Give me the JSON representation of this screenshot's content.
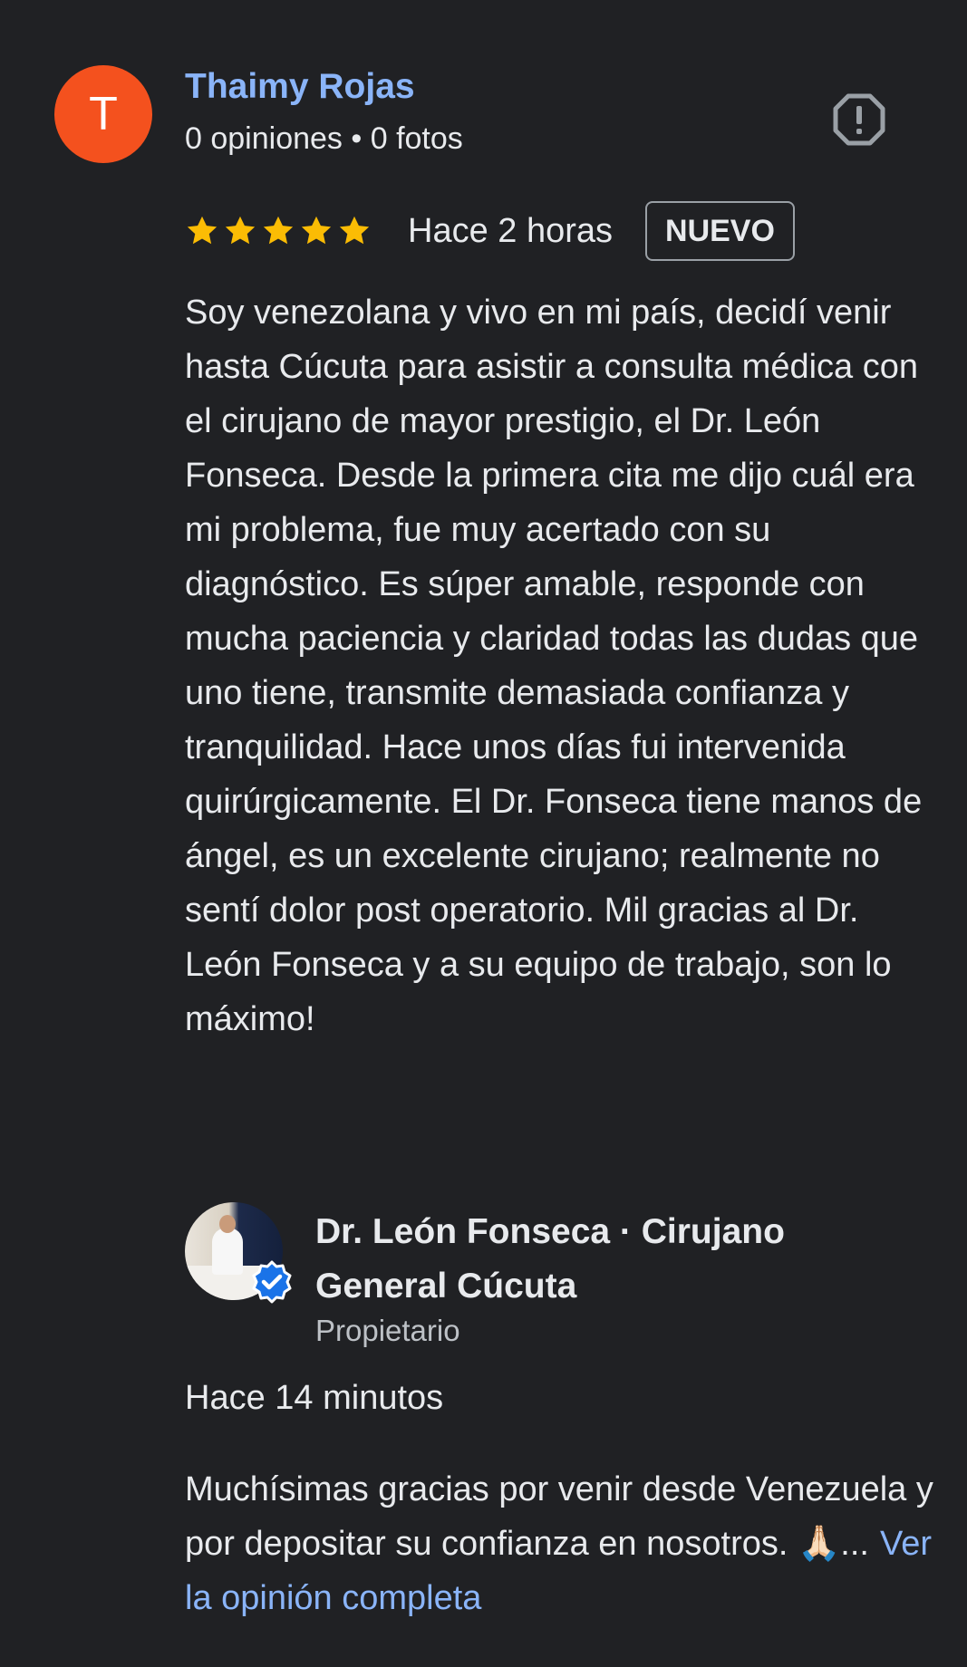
{
  "reviewer": {
    "initial": "T",
    "avatar_color": "#f4511e",
    "name": "Thaimy Rojas",
    "meta": "0 opiniones • 0 fotos"
  },
  "review": {
    "rating": 5,
    "rating_max": 5,
    "star_color": "#fbbc04",
    "time": "Hace 2 horas",
    "badge": "NUEVO",
    "text": "Soy venezolana y vivo en mi país, decidí venir hasta Cúcuta para asistir a consulta médica con el cirujano de mayor prestigio, el Dr. León Fonseca. Desde la primera cita me dijo cuál era mi problema, fue muy acertado con su diagnóstico. Es súper amable, responde con mucha paciencia y claridad todas las dudas que uno tiene, transmite demasiada confianza y tranquilidad. Hace unos días fui intervenida quirúrgicamente. El Dr. Fonseca tiene manos de ángel, es un excelente cirujano; realmente no sentí dolor post operatorio. Mil gracias al Dr. León Fonseca y a su equipo de trabajo, son lo máximo!"
  },
  "icons": {
    "report": "report-flag-icon",
    "verified": "verified-badge-icon"
  },
  "owner": {
    "name": "Dr. León Fonseca · Cirujano General Cúcuta",
    "role": "Propietario",
    "verified_color": "#1a73e8"
  },
  "reply": {
    "time": "Hace 14 minutos",
    "text": "Muchísimas gracias por venir desde Venezuela y por depositar su confianza en nosotros. 🙏🏻...",
    "see_more": "Ver la opinión completa",
    "link_color": "#8ab4f8"
  }
}
